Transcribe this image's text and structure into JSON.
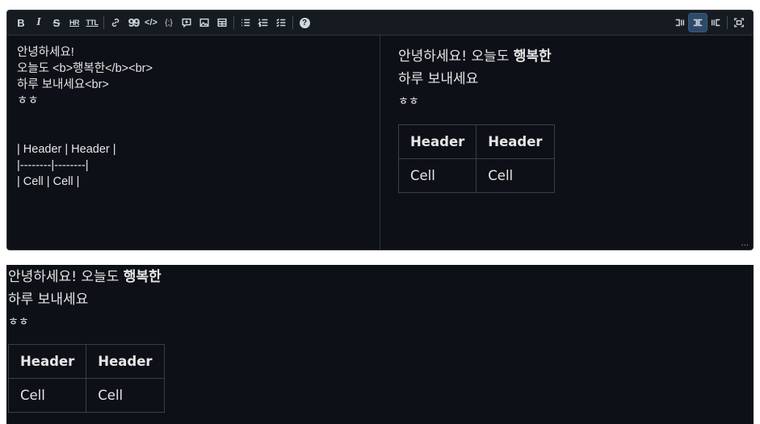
{
  "toolbar": {
    "bold": "B",
    "italic": "I",
    "strike": "S",
    "hr": "HR",
    "ttl": "TTL",
    "quote": "99",
    "code": "</>",
    "codeblock": "{;}",
    "help": "?",
    "icons": [
      "bold-icon",
      "italic-icon",
      "strikethrough-icon",
      "horizontal-rule-icon",
      "heading-icon",
      "link-icon",
      "quote-icon",
      "code-icon",
      "code-block-icon",
      "comment-icon",
      "image-icon",
      "table-icon",
      "bullet-list-icon",
      "ordered-list-icon",
      "task-list-icon",
      "help-icon",
      "editor-only-icon",
      "split-view-icon",
      "preview-only-icon",
      "fullscreen-icon"
    ]
  },
  "editor": {
    "lines": [
      "안녕하세요!",
      "오늘도 <b>행복한</b><br>",
      "하루 보내세요<br>",
      "ㅎㅎ",
      "",
      "",
      "| Header | Header |",
      "|--------|--------|",
      "| Cell | Cell |"
    ]
  },
  "preview": {
    "line1_plain": "안녕하세요! 오늘도 ",
    "line1_bold": "행복한",
    "line2": "하루 보내세요",
    "line3": "ㅎㅎ",
    "table": {
      "headers": [
        "Header",
        "Header"
      ],
      "row": [
        "Cell",
        "Cell"
      ]
    }
  },
  "resize_handle": "..."
}
